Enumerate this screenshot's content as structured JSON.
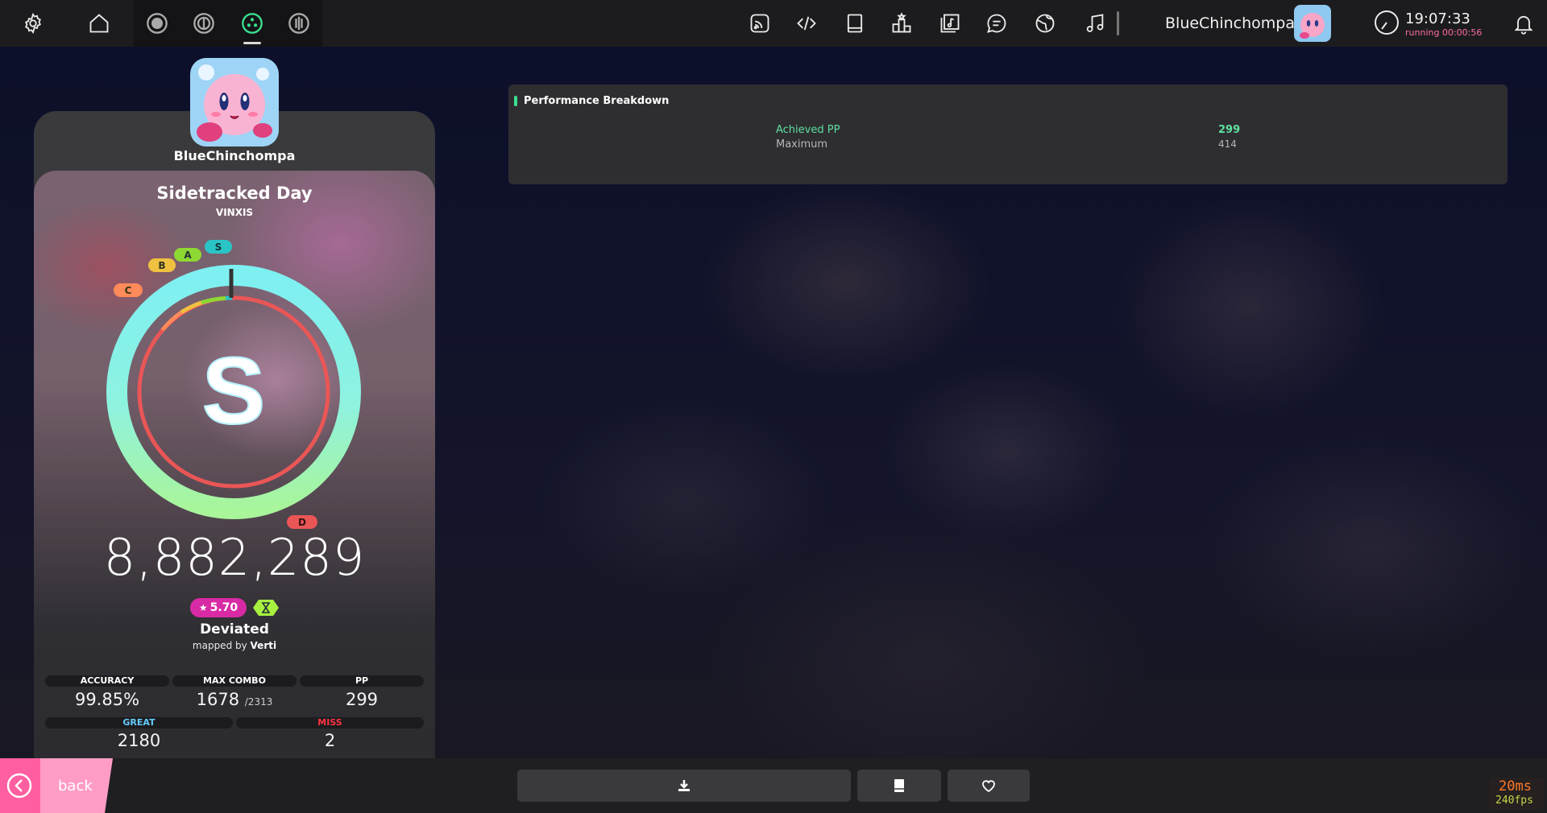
{
  "topbar": {
    "username": "BlueChinchompa",
    "time": "19:07:33",
    "running": "running 00:00:56",
    "icons": [
      "settings-icon",
      "home-icon",
      "ruleset-osu-icon",
      "ruleset-taiko-icon",
      "ruleset-catch-icon",
      "ruleset-mania-icon",
      "rss-icon",
      "code-icon",
      "book-icon",
      "ranking-icon",
      "beatmap-listing-icon",
      "chat-icon",
      "globe-icon",
      "music-icon",
      "notification-bell-icon"
    ]
  },
  "player": {
    "username": "BlueChinchompa"
  },
  "beatmap": {
    "title": "Sidetracked Day",
    "artist": "VINXIS",
    "difficulty": "Deviated",
    "mapped_by_prefix": "mapped by",
    "mapper": "Verti",
    "star_rating": "5.70"
  },
  "result": {
    "rank": "S",
    "score": "8,882,289",
    "accuracy_fraction": 0.9985,
    "rank_pills": [
      "S",
      "A",
      "B",
      "C",
      "D"
    ]
  },
  "stats": {
    "accuracy_label": "ACCURACY",
    "accuracy": "99.85%",
    "max_combo_label": "MAX COMBO",
    "max_combo": "1678",
    "max_combo_total": "/2313",
    "pp_label": "PP",
    "pp": "299",
    "great_label": "GREAT",
    "great": "2180",
    "miss_label": "MISS",
    "miss": "2"
  },
  "performance": {
    "title": "Performance Breakdown",
    "achieved_label": "Achieved PP",
    "achieved_value": "299",
    "maximum_label": "Maximum",
    "maximum_value": "414"
  },
  "bottom": {
    "back_label": "back",
    "latency": "20ms",
    "fps": "240fps"
  },
  "colors": {
    "accent_green": "#5fe0a0",
    "pink": "#ff5fa0",
    "star_badge": "#d82aa4",
    "great": "#66ccff",
    "miss": "#ff3344"
  }
}
